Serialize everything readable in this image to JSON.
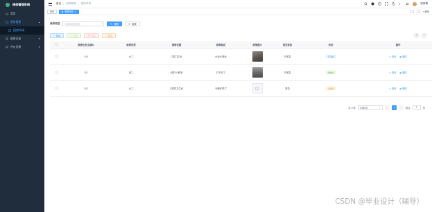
{
  "app": {
    "title": "维修管理系统",
    "brand_color": "#3fb27f",
    "accent": "#409eff"
  },
  "sidebar": {
    "items": [
      {
        "label": "首页",
        "icon": "home-icon"
      },
      {
        "label": "报修管理",
        "icon": "tool-icon",
        "open": true,
        "children": [
          {
            "label": "报修申请",
            "icon": "form-icon",
            "active": true
          }
        ]
      },
      {
        "label": "维修记录",
        "icon": "list-icon"
      },
      {
        "label": "评价反馈",
        "icon": "chat-icon"
      }
    ]
  },
  "header": {
    "breadcrumb": [
      "首页",
      "报修管理",
      "报修申请"
    ],
    "username": "张师傅"
  },
  "tags": {
    "items": [
      {
        "label": "首页"
      },
      {
        "label": "报修申请",
        "active": true
      }
    ],
    "refresh_label": "刷新"
  },
  "search": {
    "label": "维修类型",
    "placeholder": "请选择维修类型",
    "search_button": "搜索",
    "reset_button": "重置"
  },
  "toolbar": {
    "add": "新增",
    "edit": "修改",
    "delete": "删除",
    "export": "导出"
  },
  "table": {
    "columns": [
      "报修任务主键ID",
      "维修类型",
      "报修位置",
      "故障描述",
      "故障图片",
      "是否紧急",
      "状态",
      "操作"
    ],
    "rows": [
      {
        "id": "100",
        "type": "水工",
        "location": "C楼卫生间",
        "desc": "水龙头漏水",
        "urgent": "不紧急",
        "status": "已完成",
        "status_type": "info"
      },
      {
        "id": "101",
        "type": "电工",
        "location": "B楼201教室",
        "desc": "灯不亮了",
        "urgent": "不紧急",
        "status": "维修中",
        "status_type": "success"
      },
      {
        "id": "102",
        "type": "水工",
        "location": "C楼男卫生间",
        "desc": "马桶坏掉了",
        "urgent": "紧急",
        "status": "待处理",
        "status_type": "warning"
      }
    ],
    "op_edit": "修改",
    "op_delete": "删除"
  },
  "pagination": {
    "total_text": "共 3 条",
    "page_size": "10条/页",
    "current_page": "1",
    "goto_label": "前往",
    "goto_value": "1",
    "page_suffix": "页"
  },
  "watermark": "CSDN @毕业设计（辅导）"
}
